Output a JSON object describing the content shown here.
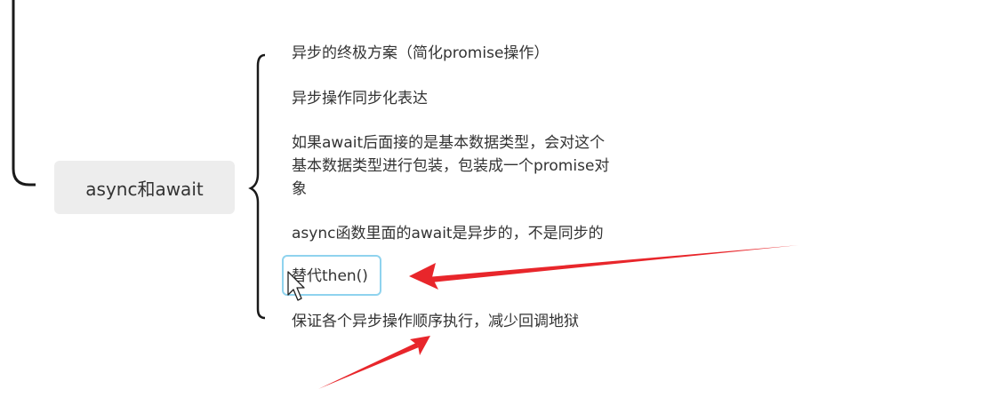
{
  "mindmap": {
    "central_node": "async和await",
    "items": [
      {
        "lines": [
          "异步的终极方案（简化promise操作）"
        ]
      },
      {
        "lines": [
          "异步操作同步化表达"
        ]
      },
      {
        "lines": [
          "如果await后面接的是基本数据类型，会对这个",
          "基本数据类型进行包装，包装成一个promise对",
          "象"
        ]
      },
      {
        "lines": [
          "async函数里面的await是异步的，不是同步的"
        ]
      },
      {
        "lines": [
          "替代then()"
        ],
        "selected": true
      },
      {
        "lines": [
          "保证各个异步操作顺序执行，减少回调地狱"
        ]
      }
    ]
  },
  "colors": {
    "connector": "#1a1a1a",
    "node_bg": "#ededed",
    "selection_border": "#8fd3ee",
    "annotation_arrow": "#e8262b"
  },
  "icons": [
    "cursor-icon"
  ]
}
